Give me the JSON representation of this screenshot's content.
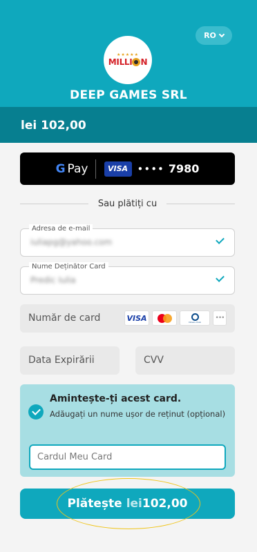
{
  "header": {
    "language": "RO",
    "logo_text": "MILLION",
    "merchant_name": "DEEP GAMES SRL",
    "brand_color": "#0fa8bd",
    "dark_color": "#077f90"
  },
  "amount_bar": {
    "amount": "lei 102,00"
  },
  "google_pay": {
    "g_label": "G",
    "pay_label": "Pay",
    "card_brand": "VISA",
    "masked_dots": "••••",
    "last4": "7980"
  },
  "divider": {
    "text": "Sau plătiți cu"
  },
  "form": {
    "email": {
      "label": "Adresa de e-mail",
      "value": "iuliapg@yahoo.com"
    },
    "cardholder": {
      "label": "Nume Deținător Card",
      "value": "Predic Iulia"
    },
    "card_number": {
      "placeholder": "Număr de card",
      "brands": [
        "VISA",
        "mastercard-icon",
        "diners-club-icon",
        "more-icon"
      ],
      "diners_text": "Diners Club",
      "more_text": "•••"
    },
    "expiry": {
      "placeholder": "Data Expirării"
    },
    "cvv": {
      "placeholder": "CVV"
    }
  },
  "remember": {
    "title": "Amintește-ți acest card.",
    "subtitle": "Adăugați un nume ușor de reținut (opțional)",
    "nickname_value": "Cardul Meu Card",
    "checked": true
  },
  "pay_button": {
    "verb": "Plătește",
    "currency": "lei",
    "amount": "102,00"
  }
}
